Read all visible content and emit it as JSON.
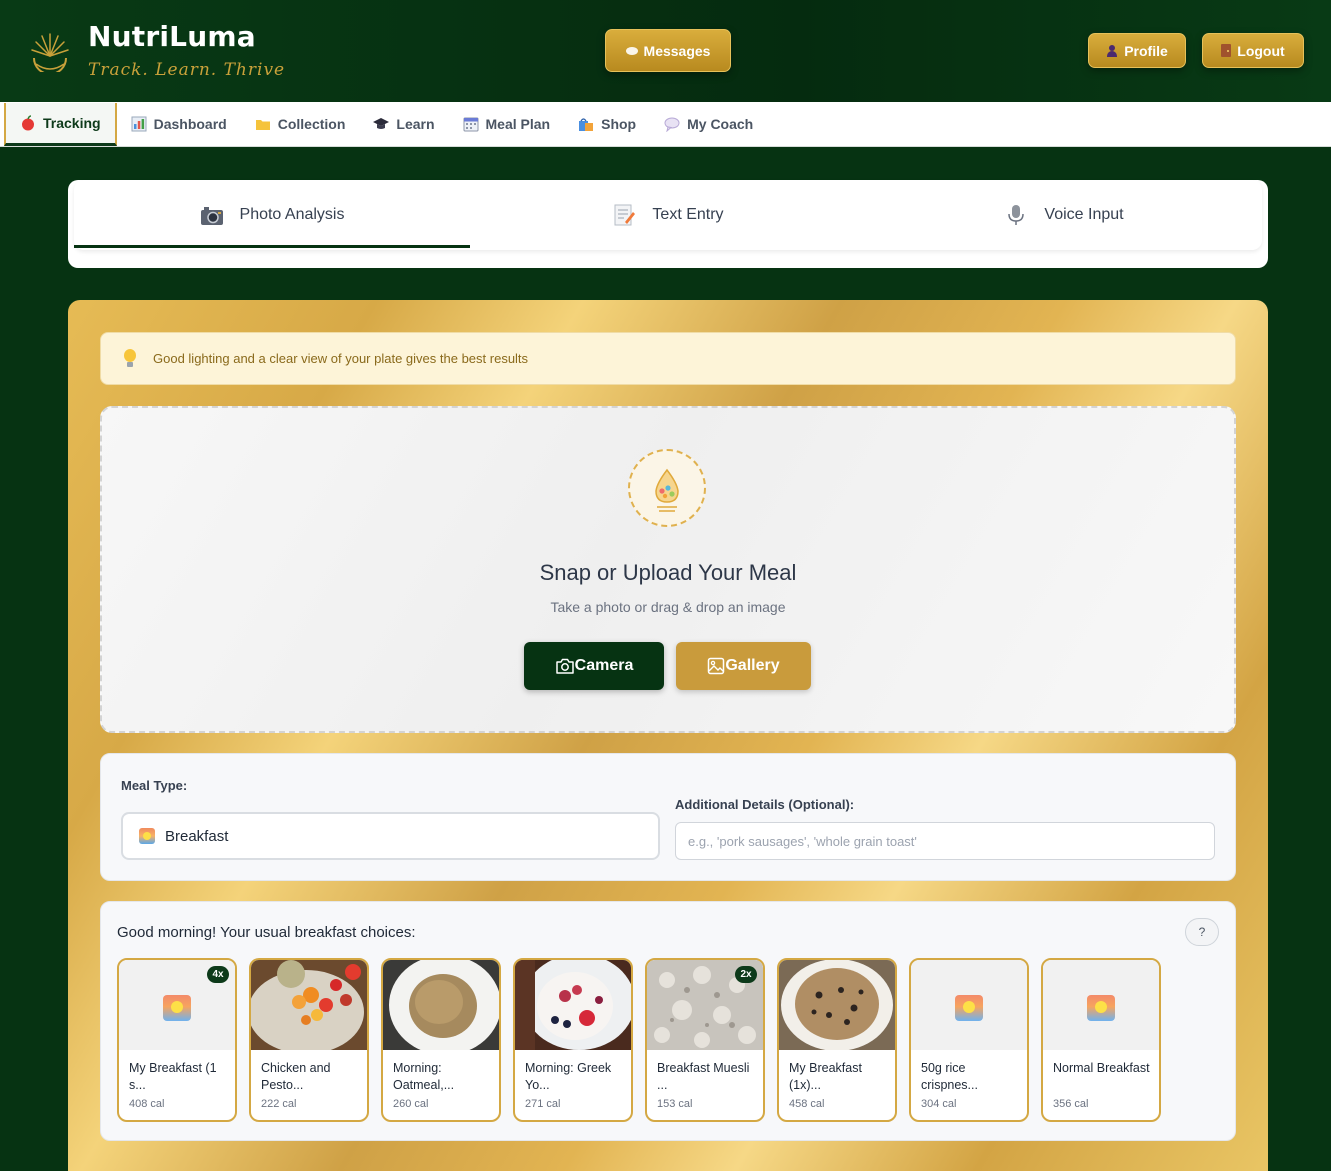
{
  "header": {
    "brand": "NutriLuma",
    "tagline": "Track. Learn. Thrive",
    "messages_label": "Messages",
    "profile_label": "Profile",
    "logout_label": "Logout"
  },
  "nav": [
    {
      "label": "Tracking",
      "icon": "apple-icon",
      "active": true
    },
    {
      "label": "Dashboard",
      "icon": "chart-icon"
    },
    {
      "label": "Collection",
      "icon": "folder-icon"
    },
    {
      "label": "Learn",
      "icon": "graduation-cap-icon"
    },
    {
      "label": "Meal Plan",
      "icon": "calendar-icon"
    },
    {
      "label": "Shop",
      "icon": "shopping-bag-icon"
    },
    {
      "label": "My Coach",
      "icon": "speech-bubble-icon"
    }
  ],
  "tabs": [
    {
      "label": "Photo Analysis",
      "icon": "camera-icon",
      "active": true
    },
    {
      "label": "Text Entry",
      "icon": "memo-icon"
    },
    {
      "label": "Voice Input",
      "icon": "microphone-icon"
    }
  ],
  "tip": "Good lighting and a clear view of your plate gives the best results",
  "upload": {
    "title": "Snap or Upload Your Meal",
    "subtitle": "Take a photo or drag & drop an image",
    "camera_label": "Camera",
    "gallery_label": "Gallery"
  },
  "meal_form": {
    "meal_type_label": "Meal Type:",
    "meal_type_value": "Breakfast",
    "details_label": "Additional Details (Optional):",
    "details_placeholder": "e.g., 'pork sausages', 'whole grain toast'"
  },
  "usual": {
    "title": "Good morning! Your usual breakfast choices:",
    "help": "?",
    "items": [
      {
        "name": "My Breakfast (1 s...",
        "cal": "408 cal",
        "badge": "4x",
        "image": "placeholder"
      },
      {
        "name": "Chicken and Pesto...",
        "cal": "222 cal",
        "badge": "",
        "image": "fruit-plate"
      },
      {
        "name": "Morning: Oatmeal,...",
        "cal": "260 cal",
        "badge": "",
        "image": "oatmeal-bowl"
      },
      {
        "name": "Morning: Greek Yo...",
        "cal": "271 cal",
        "badge": "",
        "image": "yogurt-berries"
      },
      {
        "name": "Breakfast Muesli ...",
        "cal": "153 cal",
        "badge": "2x",
        "image": "muesli"
      },
      {
        "name": "My Breakfast (1x)...",
        "cal": "458 cal",
        "badge": "",
        "image": "porridge-raisins"
      },
      {
        "name": "50g rice crispnes...",
        "cal": "304 cal",
        "badge": "",
        "image": "placeholder"
      },
      {
        "name": "Normal Breakfast",
        "cal": "356 cal",
        "badge": "",
        "image": "placeholder"
      }
    ]
  },
  "colors": {
    "primary_green": "#063312",
    "gold": "#d4a843",
    "gold_button": "#c99b3c"
  }
}
